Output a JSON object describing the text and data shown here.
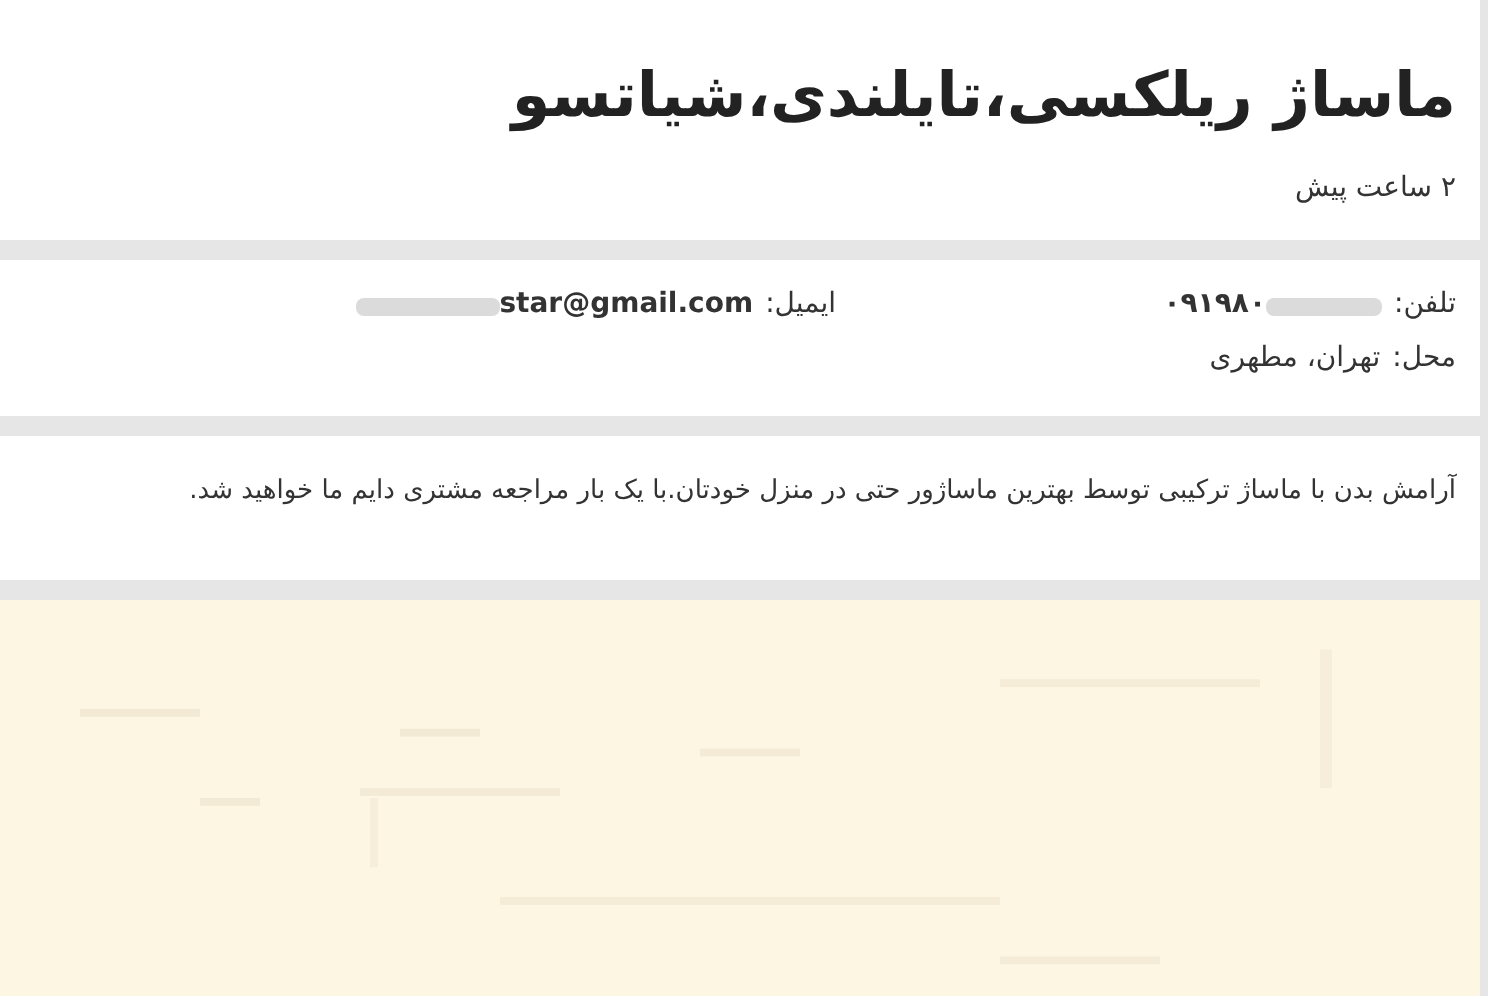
{
  "title": "ماساژ ریلکسی،تایلندی،شیاتسو",
  "time": "۲ ساعت پیش",
  "contact": {
    "phone_label": "تلفن:",
    "phone": "۰۹۱۹۸۰",
    "email_label": "ایمیل:",
    "email": "star@gmail.com",
    "location_label": "محل:",
    "location": "تهران، مطهری"
  },
  "description": "آرامش بدن با ماساژ ترکیبی توسط بهترین ماساژور حتی در منزل خودتان.با یک بار مراجعه مشتری دایم ما خواهید شد."
}
